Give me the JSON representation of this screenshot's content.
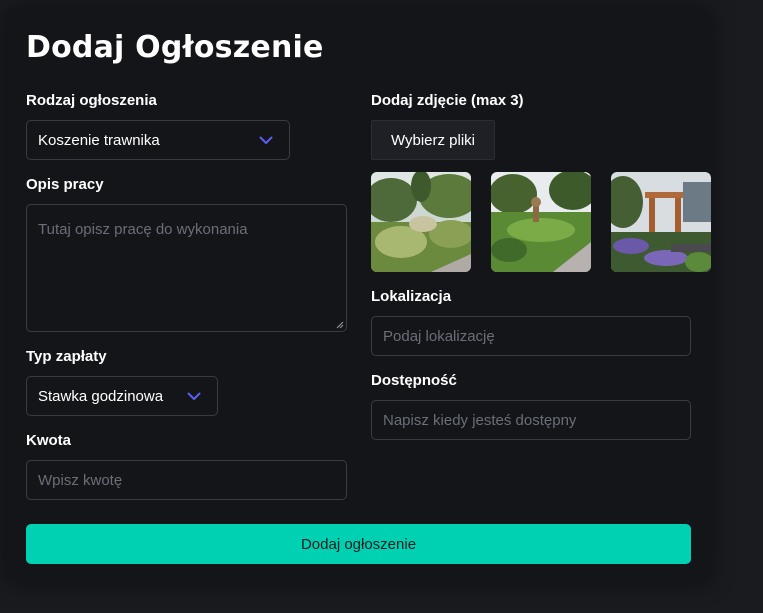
{
  "form": {
    "title": "Dodaj Ogłoszenie",
    "type": {
      "label": "Rodzaj ogłoszenia",
      "selected": "Koszenie trawnika"
    },
    "description": {
      "label": "Opis pracy",
      "placeholder": "Tutaj opisz pracę do wykonania"
    },
    "payment_type": {
      "label": "Typ zapłaty",
      "selected": "Stawka godzinowa"
    },
    "amount": {
      "label": "Kwota",
      "placeholder": "Wpisz kwotę"
    },
    "photos": {
      "label": "Dodaj zdjęcie (max 3)",
      "button_label": "Wybierz pliki",
      "thumbnails": [
        "garden-photo-1",
        "garden-photo-2",
        "garden-photo-3"
      ]
    },
    "location": {
      "label": "Lokalizacja",
      "placeholder": "Podaj lokalizację"
    },
    "availability": {
      "label": "Dostępność",
      "placeholder": "Napisz kiedy jesteś dostępny"
    },
    "submit_label": "Dodaj ogłoszenie"
  },
  "colors": {
    "background": "#1a1b1f",
    "card": "#141518",
    "border": "#3a3c44",
    "accent": "#00d1b2",
    "chevron": "#5a5ff0"
  },
  "icons": {
    "select_arrow": "chevron-down-icon",
    "resize": "resize-grip-icon"
  }
}
